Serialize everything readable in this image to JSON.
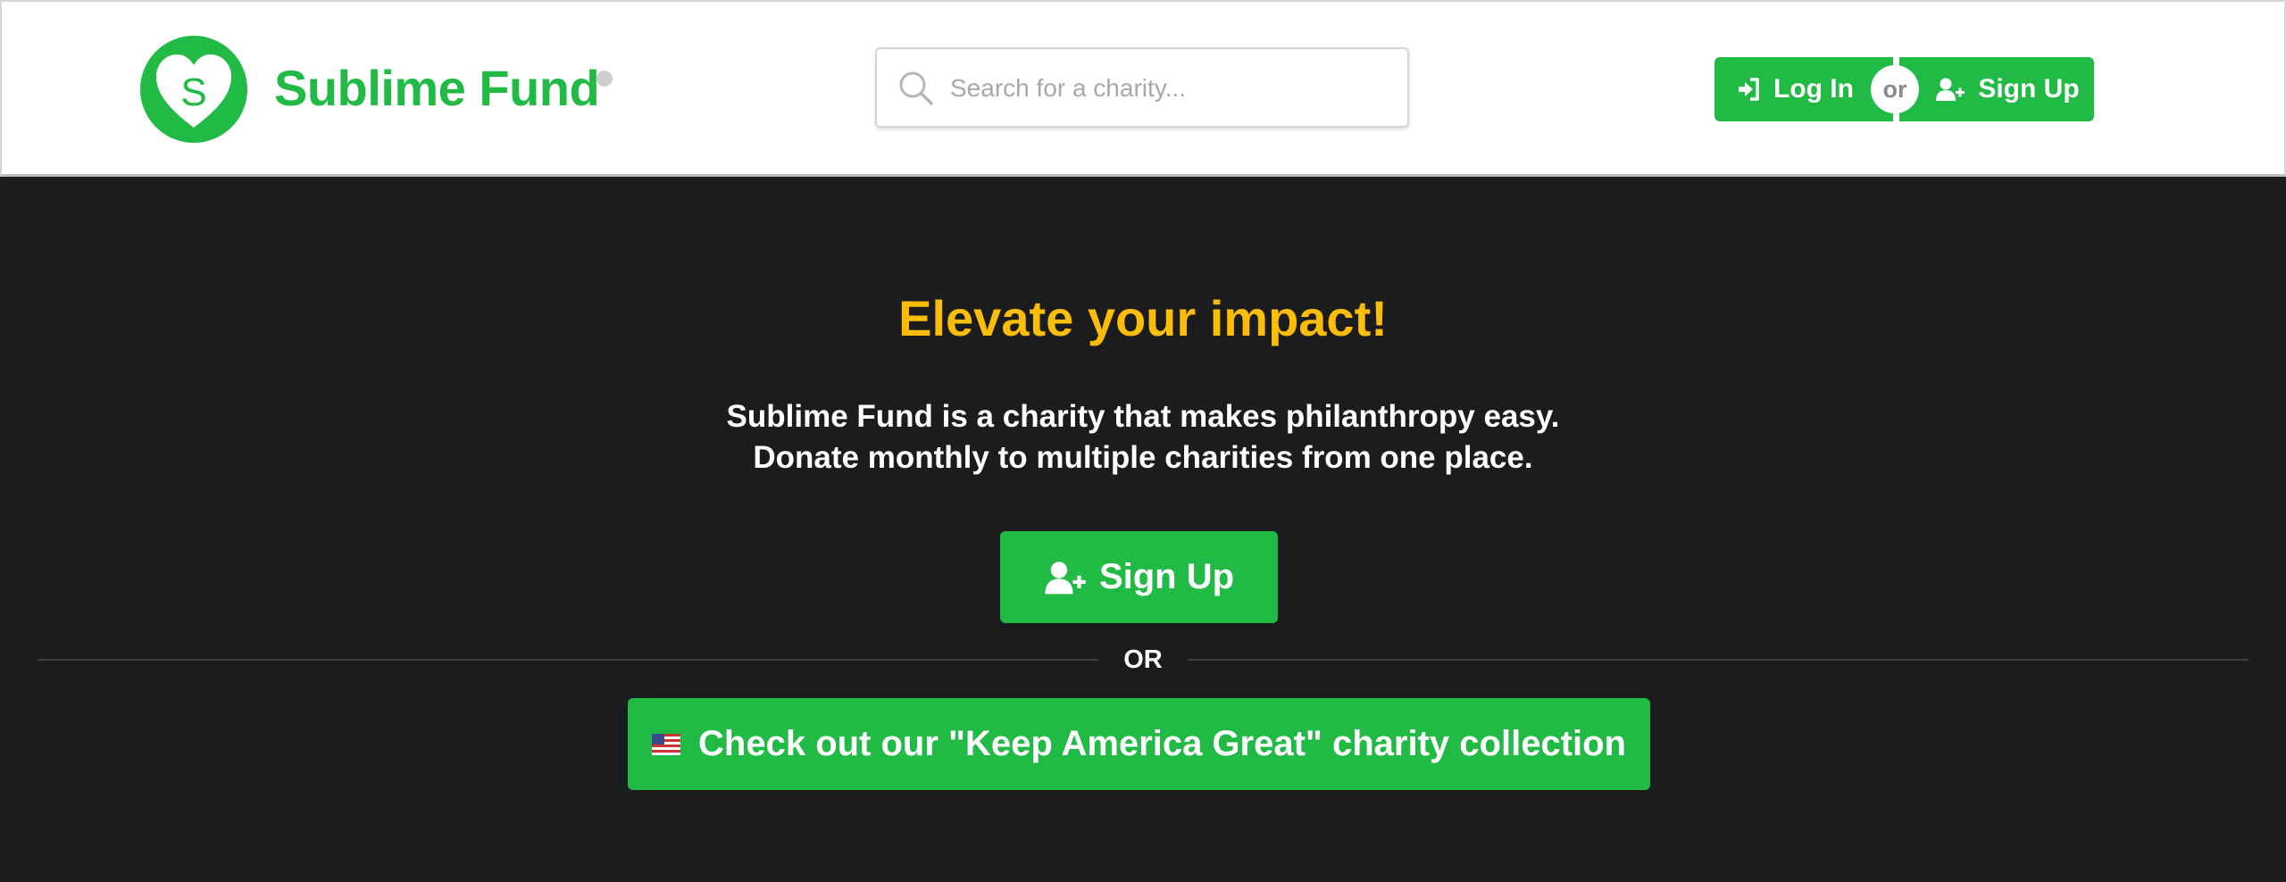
{
  "header": {
    "logo_letter": "S",
    "brand_name": "Sublime Fund",
    "search": {
      "placeholder": "Search for a charity..."
    },
    "login_label": "Log In",
    "or_label": "or",
    "signup_label": "Sign Up"
  },
  "hero": {
    "title": "Elevate your impact!",
    "line1": "Sublime Fund is a charity that makes philanthropy easy.",
    "line2": "Donate monthly to multiple charities from one place.",
    "signup_label": "Sign Up",
    "divider_label": "OR",
    "collection_label": "Check out our \"Keep America Great\" charity collection"
  },
  "colors": {
    "brand_green": "#21ba45",
    "accent_yellow": "#fbbd08",
    "dark_background": "#1b1c1d",
    "or_badge_text": "#8a8a8a"
  },
  "icons": {
    "logo": "heart-icon",
    "search": "search-icon",
    "login": "sign-in-icon",
    "signup": "add-user-icon",
    "collection": "us-flag-icon"
  }
}
